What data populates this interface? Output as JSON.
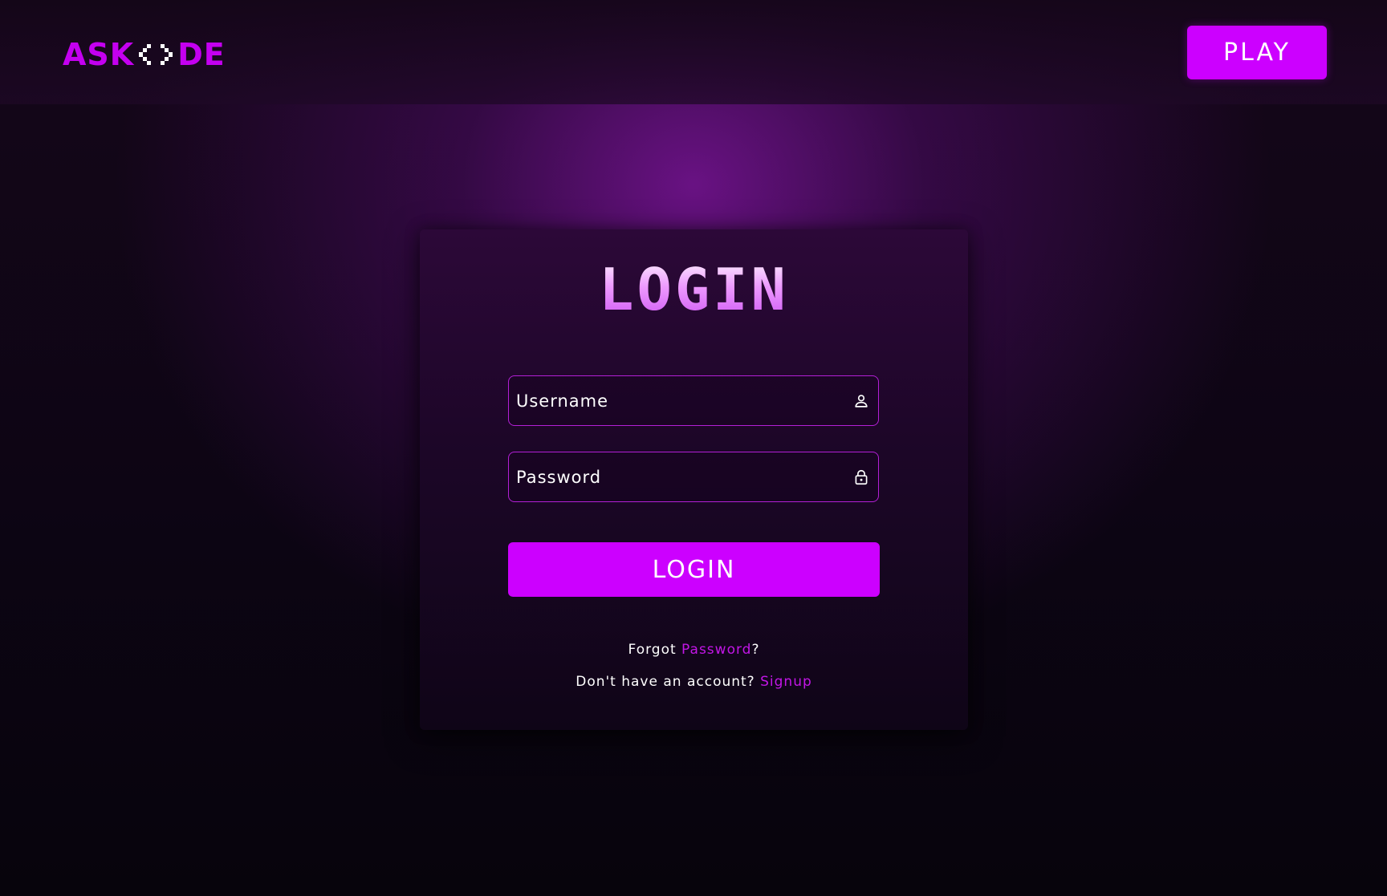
{
  "header": {
    "logo": {
      "left": "ASK",
      "right": "DE"
    },
    "play_label": "PLAY"
  },
  "login": {
    "title": "LOGIN",
    "username": {
      "placeholder": "Username",
      "icon": "user-icon"
    },
    "password": {
      "placeholder": "Password",
      "icon": "lock-icon"
    },
    "submit_label": "LOGIN",
    "forgot": {
      "prefix": "Forgot ",
      "link": "Password",
      "suffix": "?"
    },
    "signup": {
      "prefix": "Don't have an account? ",
      "link": "Signup"
    }
  },
  "colors": {
    "accent": "#cc00ff",
    "link": "#c216e6",
    "field_border": "#b41fd6",
    "background": "#070410"
  }
}
